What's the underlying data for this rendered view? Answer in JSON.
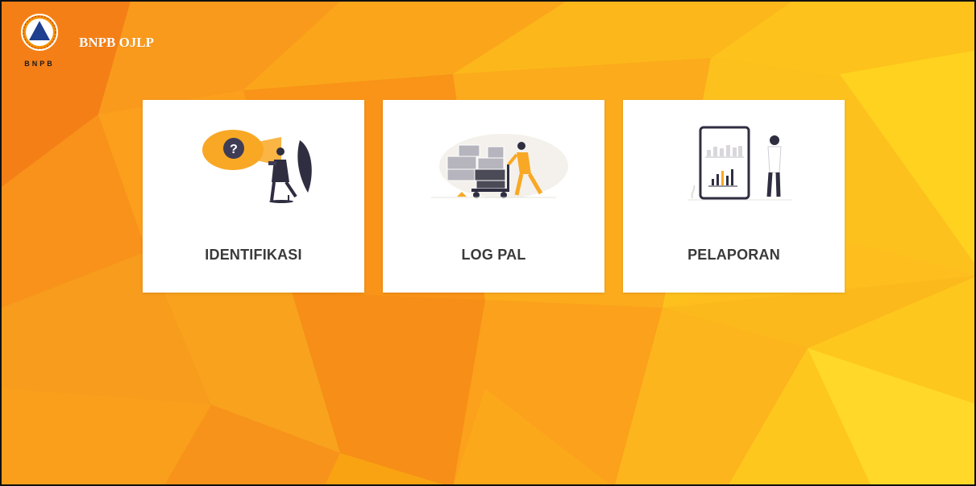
{
  "header": {
    "logo_text": "BNPB",
    "title": "BNPB OJLP"
  },
  "menu": {
    "items": [
      {
        "label": "IDENTIFIKASI",
        "icon": "question-megaphone-icon"
      },
      {
        "label": "LOG PAL",
        "icon": "logistics-cart-icon"
      },
      {
        "label": "PELAPORAN",
        "icon": "report-chart-icon"
      }
    ]
  },
  "colors": {
    "background_orange": "#f7a20c",
    "background_yellow": "#ffd000",
    "accent": "#f9a825",
    "card": "#ffffff",
    "label": "#3a3a3a",
    "logo_blue": "#1f3f8f",
    "logo_orange": "#f39200"
  }
}
